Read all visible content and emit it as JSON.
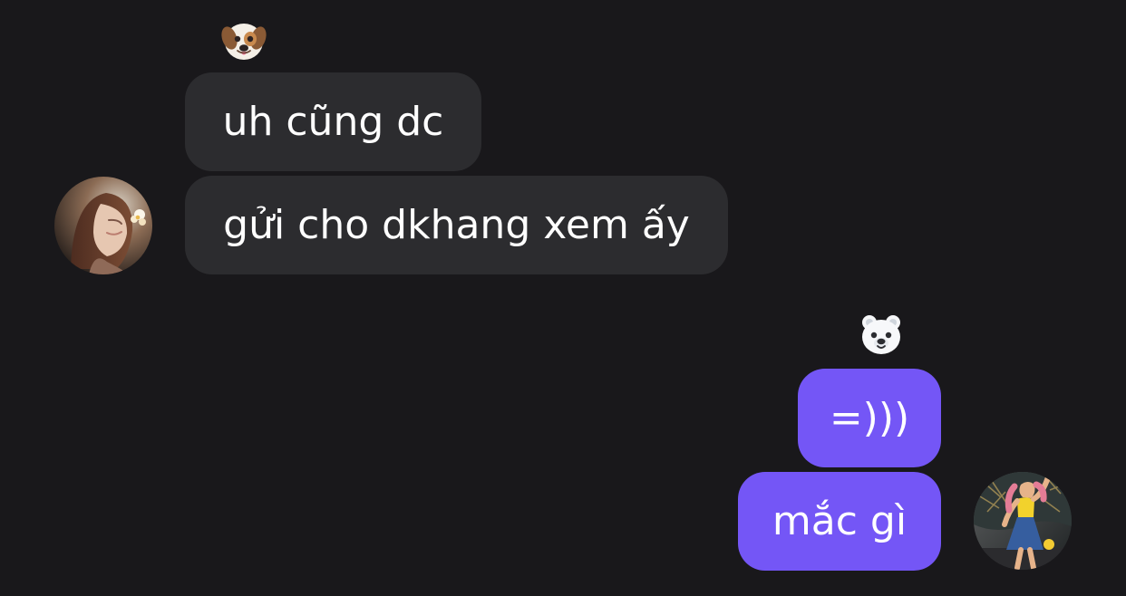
{
  "thread": {
    "incoming": {
      "reaction_icon": "dog-face-icon",
      "avatar_icon": "contact-avatar-icon",
      "messages": [
        "uh cũng dc",
        "gửi cho dkhang xem ấy"
      ]
    },
    "outgoing": {
      "reaction_icon": "polar-bear-icon",
      "avatar_icon": "user-avatar-icon",
      "messages": [
        "=)))",
        "mắc gì"
      ]
    }
  },
  "colors": {
    "background": "#19181b",
    "incoming_bubble": "#2c2c2f",
    "outgoing_bubble": "#7456f6",
    "text": "#ffffff"
  }
}
